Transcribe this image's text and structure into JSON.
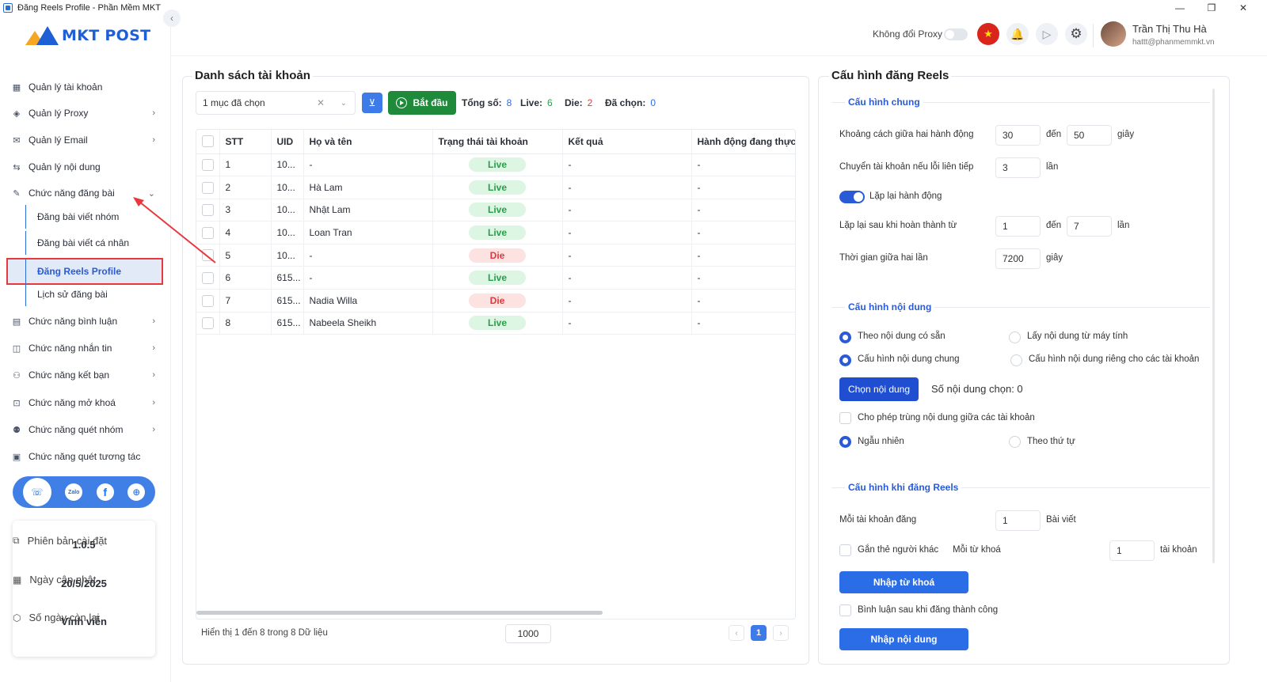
{
  "window": {
    "title": "Đăng Reels Profile - Phần Mềm MKT",
    "minimize": "—",
    "maximize": "❐",
    "close": "✕"
  },
  "logo": {
    "text": "MKT POST"
  },
  "sidebar": {
    "collapse_icon": "‹",
    "items": [
      {
        "label": "Quản lý tài khoản",
        "icon": "▦",
        "chevron": ""
      },
      {
        "label": "Quản lý Proxy",
        "icon": "◈",
        "chevron": "›"
      },
      {
        "label": "Quản lý Email",
        "icon": "✉",
        "chevron": "›"
      },
      {
        "label": "Quản lý nội dung",
        "icon": "⇆",
        "chevron": ""
      },
      {
        "label": "Chức năng đăng bài",
        "icon": "✎",
        "chevron": "⌄"
      },
      {
        "label": "Chức năng bình luận",
        "icon": "▤",
        "chevron": "›"
      },
      {
        "label": "Chức năng nhắn tin",
        "icon": "◫",
        "chevron": "›"
      },
      {
        "label": "Chức năng kết bạn",
        "icon": "⚇",
        "chevron": "›"
      },
      {
        "label": "Chức năng mở khoá",
        "icon": "⊡",
        "chevron": "›"
      },
      {
        "label": "Chức năng quét nhóm",
        "icon": "⚉",
        "chevron": "›"
      },
      {
        "label": "Chức năng quét tương tác",
        "icon": "▣",
        "chevron": ""
      }
    ],
    "sub_items": [
      {
        "label": "Đăng bài viết nhóm"
      },
      {
        "label": "Đăng bài viết cá nhân"
      },
      {
        "label": "Đăng Reels Profile"
      },
      {
        "label": "Lịch sử đăng bài"
      }
    ],
    "social": {
      "support": "☏",
      "zalo": "Zalo",
      "facebook": "f",
      "web": "⊕"
    },
    "info": {
      "version_label": "Phiên bản cài đặt",
      "version_value": "1.0.5",
      "update_label": "Ngày cập nhật",
      "update_value": "20/5/2025",
      "days_label": "Số ngày còn lại",
      "days_value": "Vĩnh viễn"
    }
  },
  "header": {
    "proxy_label": "Không đổi Proxy",
    "flag_icon": "★",
    "bell_icon": "🔔",
    "play_icon": "▷",
    "gear_icon": "⚙",
    "user_name": "Trần Thị Thu Hà",
    "user_email": "hattt@phanmemmkt.vn"
  },
  "accounts": {
    "title": "Danh sách tài khoản",
    "select_value": "1 mục đã chọn",
    "clear_icon": "✕",
    "dropdown_icon": "⌄",
    "filter_icon": "⊻",
    "start_label": "Bắt đầu",
    "stats": {
      "total_label": "Tổng số:",
      "total": "8",
      "live_label": "Live:",
      "live": "6",
      "die_label": "Die:",
      "die": "2",
      "selected_label": "Đã chọn:",
      "selected": "0"
    },
    "columns": [
      "STT",
      "UID",
      "Họ và tên",
      "Trạng thái tài khoản",
      "Kết quả",
      "Hành động đang thực hiện"
    ],
    "rows": [
      {
        "stt": "1",
        "uid": "10...",
        "name": "-",
        "status": "Live",
        "result": "-",
        "action": "-"
      },
      {
        "stt": "2",
        "uid": "10...",
        "name": "Hà Lam",
        "status": "Live",
        "result": "-",
        "action": "-"
      },
      {
        "stt": "3",
        "uid": "10...",
        "name": "Nhật Lam",
        "status": "Live",
        "result": "-",
        "action": "-"
      },
      {
        "stt": "4",
        "uid": "10...",
        "name": "Loan Tran",
        "status": "Live",
        "result": "-",
        "action": "-"
      },
      {
        "stt": "5",
        "uid": "10...",
        "name": "-",
        "status": "Die",
        "result": "-",
        "action": "-"
      },
      {
        "stt": "6",
        "uid": "615...",
        "name": "-",
        "status": "Live",
        "result": "-",
        "action": "-"
      },
      {
        "stt": "7",
        "uid": "615...",
        "name": "Nadia Willa",
        "status": "Die",
        "result": "-",
        "action": "-"
      },
      {
        "stt": "8",
        "uid": "615...",
        "name": "Nabeela Sheikh",
        "status": "Live",
        "result": "-",
        "action": "-"
      }
    ],
    "footer_text": "Hiển thị 1 đến 8 trong 8 Dữ liệu",
    "page_size": "1000",
    "prev": "‹",
    "page": "1",
    "next": "›"
  },
  "config": {
    "title": "Cấu hình đăng Reels",
    "general": {
      "title": "Cấu hình chung",
      "interval_label": "Khoảng cách giữa hai hành động",
      "interval_from": "30",
      "to_label": "đến",
      "interval_to": "50",
      "seconds": "giây",
      "switch_label": "Chuyển tài khoản nếu lỗi liên tiếp",
      "switch_value": "3",
      "times": "lần",
      "repeat_label": "Lặp lại hành động",
      "repeat_after_label": "Lặp lại sau khi hoàn thành từ",
      "repeat_from": "1",
      "repeat_to": "7",
      "wait_label": "Thời gian giữa hai lần",
      "wait_value": "7200"
    },
    "content": {
      "title": "Cấu hình nội dung",
      "opt_existing": "Theo nội dung có sẵn",
      "opt_computer": "Lấy nội dung từ máy tính",
      "opt_common": "Cấu hình nội dung chung",
      "opt_separate": "Cấu hình nội dung riêng cho các tài khoản",
      "choose_btn": "Chọn nội dung",
      "count_label": "Số nội dung chọn: 0",
      "allow_dup": "Cho phép trùng nội dung giữa các tài khoản",
      "random": "Ngẫu nhiên",
      "sequential": "Theo thứ tự"
    },
    "reels": {
      "title": "Cấu hình khi đăng Reels",
      "per_account_label": "Mỗi tài khoản đăng",
      "per_account_value": "1",
      "posts": "Bài viết",
      "tag_label": "Gắn thẻ người khác",
      "per_keyword_label": "Mỗi từ khoá",
      "per_keyword_value": "1",
      "accounts": "tài khoản",
      "import_keywords": "Nhập từ khoá",
      "comment_label": "Bình luận sau khi đăng thành công",
      "import_content": "Nhập nội dung"
    }
  },
  "colors": {
    "primary": "#2a5bd7",
    "start_green": "#1f8b3a",
    "live_green": "#2a9d4b",
    "die_red": "#e0383c",
    "annotation_red": "#e8383d"
  }
}
